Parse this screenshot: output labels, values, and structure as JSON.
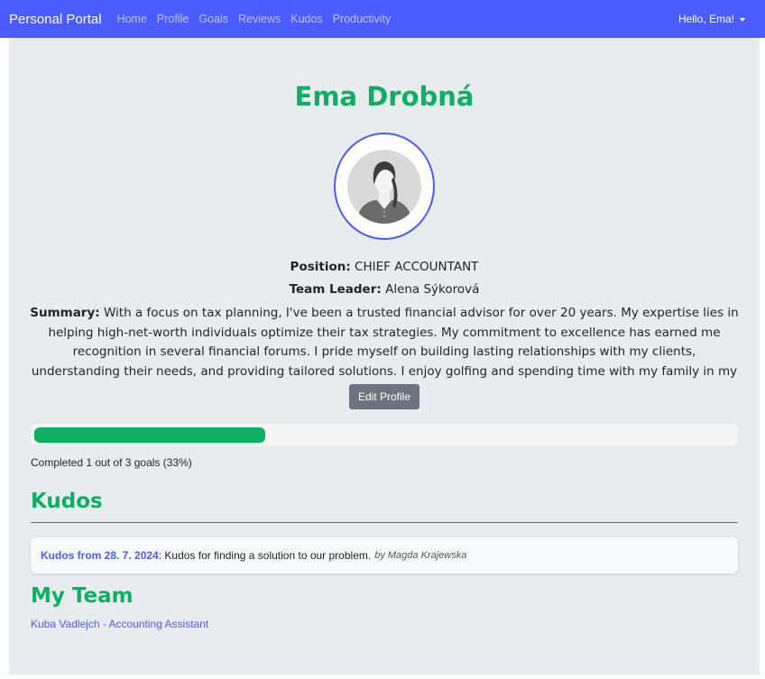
{
  "navbar": {
    "brand": "Personal Portal",
    "links": [
      "Home",
      "Profile",
      "Goals",
      "Reviews",
      "Kudos",
      "Productivity"
    ],
    "user_greeting": "Hello, Ema!",
    "color": "#4a5cff"
  },
  "profile": {
    "name": "Ema Drobná",
    "avatar_icon": "female-avatar-icon",
    "position_label": "Position:",
    "position_value": "CHIEF ACCOUNTANT",
    "leader_label": "Team Leader:",
    "leader_value": "Alena Sýkorová",
    "summary_label": "Summary:",
    "summary_text": "With a focus on tax planning, I've been a trusted financial advisor for over 20 years. My expertise lies in helping high-net-worth individuals optimize their tax strategies. My commitment to excellence has earned me recognition in several financial forums. I pride myself on building lasting relationships with my clients, understanding their needs, and providing tailored solutions. I enjoy golfing and spending time with my family in my free time.",
    "edit_button": "Edit Profile"
  },
  "goals": {
    "completed": 1,
    "total": 3,
    "progress_fraction": 0.33,
    "progress_text": "Completed 1 out of 3 goals (33%)"
  },
  "kudos": {
    "heading": "Kudos",
    "items": [
      {
        "title": "Kudos from 28. 7. 2024",
        "message": "Kudos for finding a solution to our problem.",
        "by": "by Magda Krajewska"
      }
    ]
  },
  "team": {
    "heading": "My Team",
    "members": [
      "Kuba Vadlejch - Accounting Assistant"
    ]
  },
  "colors": {
    "accent_green": "#0daf62",
    "accent_blue": "#4a5cff",
    "background": "#e9ecef"
  }
}
